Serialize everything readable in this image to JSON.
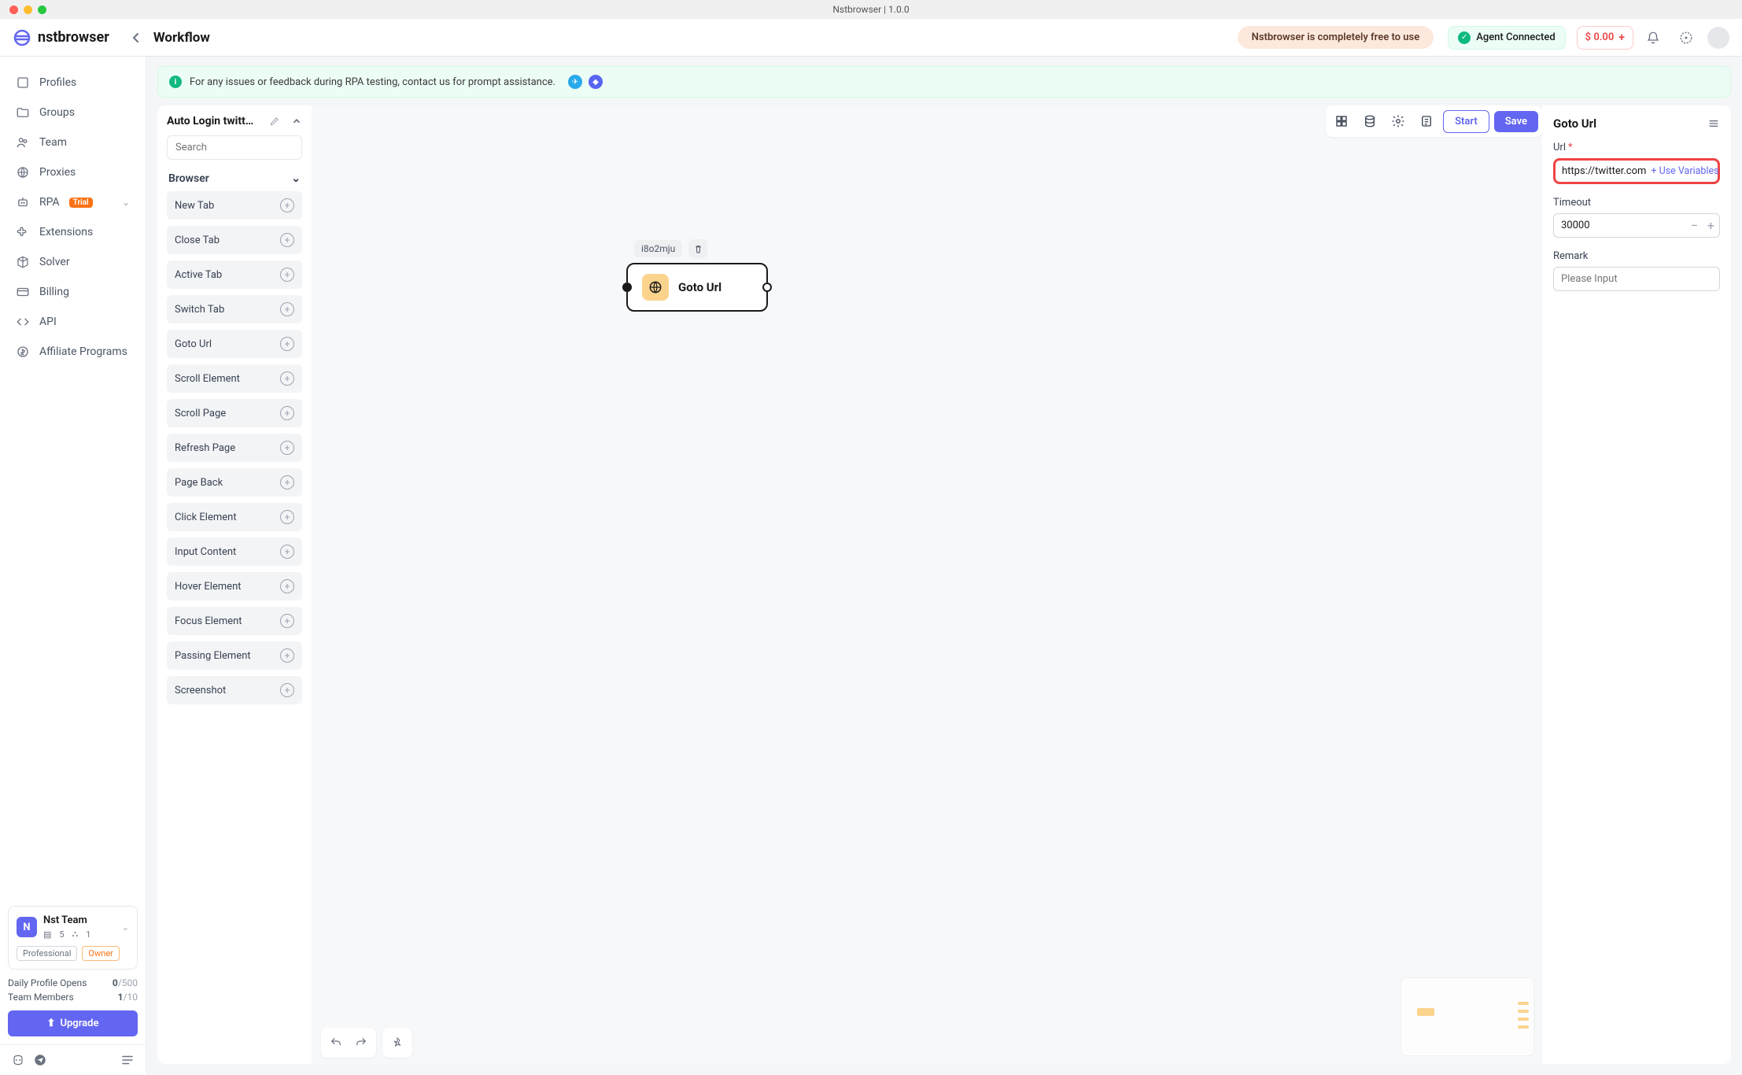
{
  "window_title": "Nstbrowser | 1.0.0",
  "brand": "nstbrowser",
  "page_title": "Workflow",
  "free_banner": "Nstbrowser is completely free to use",
  "agent_status": "Agent Connected",
  "balance": "$ 0.00",
  "nav": {
    "profiles": "Profiles",
    "groups": "Groups",
    "team": "Team",
    "proxies": "Proxies",
    "rpa": "RPA",
    "rpa_badge": "Trial",
    "extensions": "Extensions",
    "solver": "Solver",
    "billing": "Billing",
    "api": "API",
    "affiliate": "Affiliate Programs"
  },
  "team_card": {
    "initial": "N",
    "name": "Nst Team",
    "stat1": "5",
    "stat2": "1",
    "badge_pro": "Professional",
    "badge_owner": "Owner"
  },
  "usage": {
    "daily_label": "Daily Profile Opens",
    "daily_value": "0",
    "daily_limit": "/500",
    "members_label": "Team Members",
    "members_value": "1",
    "members_limit": "/10"
  },
  "upgrade": "Upgrade",
  "notice": "For any issues or feedback during RPA testing, contact us for prompt assistance.",
  "workflow_name": "Auto Login twitt…",
  "search_placeholder": "Search",
  "category_browser": "Browser",
  "nodes": {
    "new_tab": "New Tab",
    "close_tab": "Close Tab",
    "active_tab": "Active Tab",
    "switch_tab": "Switch Tab",
    "goto_url": "Goto Url",
    "scroll_element": "Scroll Element",
    "scroll_page": "Scroll Page",
    "refresh_page": "Refresh Page",
    "page_back": "Page Back",
    "click_element": "Click Element",
    "input_content": "Input Content",
    "hover_element": "Hover Element",
    "focus_element": "Focus Element",
    "passing_element": "Passing Element",
    "screenshot": "Screenshot"
  },
  "btn_start": "Start",
  "btn_save": "Save",
  "canvas_node": {
    "id": "i8o2mju",
    "label": "Goto Url"
  },
  "props": {
    "title": "Goto Url",
    "url_label": "Url",
    "url_value": "https://twitter.com",
    "use_variables": "+ Use Variables",
    "timeout_label": "Timeout",
    "timeout_value": "30000",
    "remark_label": "Remark",
    "remark_placeholder": "Please Input"
  }
}
